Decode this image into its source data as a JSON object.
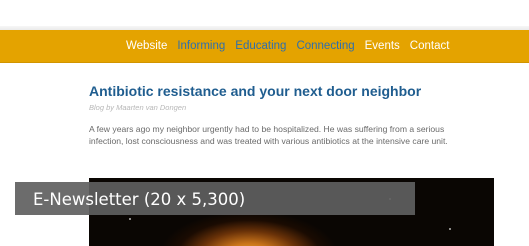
{
  "nav": {
    "items": [
      {
        "label": "Website",
        "style": "white"
      },
      {
        "label": "Informing",
        "style": "blue"
      },
      {
        "label": "Educating",
        "style": "blue"
      },
      {
        "label": "Connecting",
        "style": "blue"
      },
      {
        "label": "Events",
        "style": "white"
      },
      {
        "label": "Contact",
        "style": "white"
      }
    ],
    "bar_color": "#e4a300"
  },
  "article": {
    "title": "Antibiotic resistance and your next door neighbor",
    "byline": "Blog by Maarten van Dongen",
    "lines": [
      "A few years ago my neighbor  urgently had to be hospitalized. He was suffering from a serious",
      "infection, lost consciousness and was treated with various antibiotics at the intensive care unit."
    ]
  },
  "overlay": {
    "label": "E-Newsletter (20 x 5,300)"
  }
}
